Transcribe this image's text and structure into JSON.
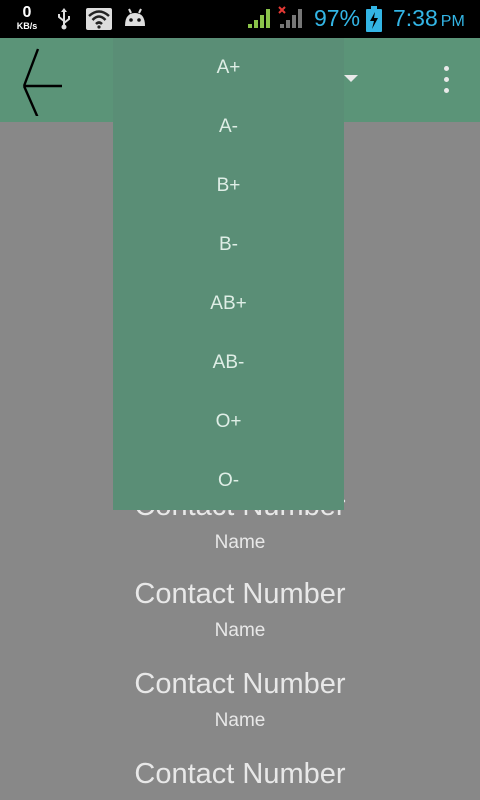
{
  "status_bar": {
    "data_rate": "0",
    "data_rate_unit": "KB/s",
    "battery_percent": "97%",
    "time": "7:38",
    "ampm": "PM",
    "icons": [
      "usb-icon",
      "wifi-icon",
      "android-icon",
      "signal-icon",
      "signal-no-data-icon",
      "battery-charging-icon"
    ]
  },
  "toolbar": {
    "back_icon": "arrow-left-icon",
    "overflow_icon": "more-vertical-icon",
    "dropdown_icon": "triangle-down-icon"
  },
  "blood_groups": [
    "A+",
    "A-",
    "B+",
    "B-",
    "AB+",
    "AB-",
    "O+",
    "O-"
  ],
  "list": [
    {
      "contact": "Contact Number",
      "name": "Name"
    },
    {
      "contact": "Contact Number",
      "name": "Name"
    },
    {
      "contact": "Contact Number",
      "name": "Name"
    },
    {
      "contact": "Contact Number",
      "name": ""
    }
  ],
  "colors": {
    "toolbar": "#5b9478",
    "dropdown": "#5a8e76",
    "background": "#888888",
    "status_accent": "#33b5e5"
  }
}
